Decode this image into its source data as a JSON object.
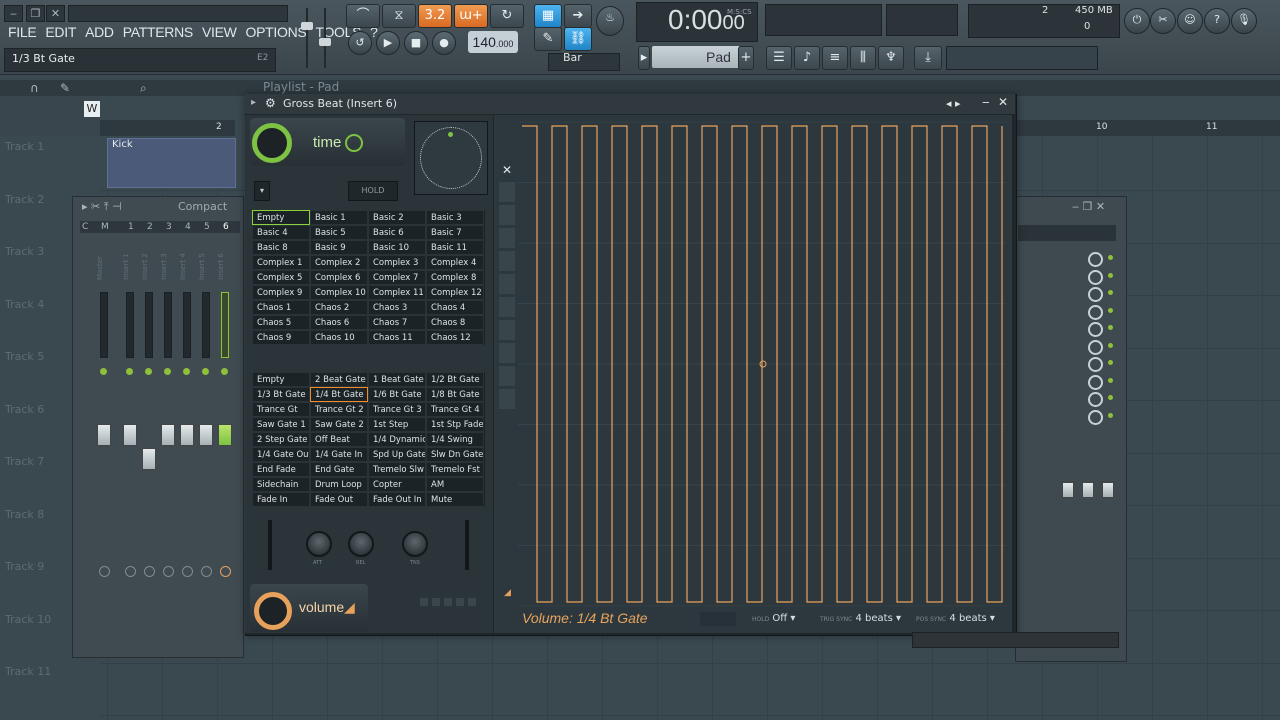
{
  "menu": [
    "FILE",
    "EDIT",
    "ADD",
    "PATTERNS",
    "VIEW",
    "OPTIONS",
    "TOOLS",
    "?"
  ],
  "hint": {
    "text": "1/3 Bt Gate",
    "shortcut": "E2"
  },
  "toolbar": {
    "pattern_counter": "3.2",
    "tempo": "140",
    "tempo_decimal": ".000",
    "time": "0:00",
    "time_sub": "00",
    "time_unit": "M:S:CS",
    "cpu": "2",
    "memory": "450 MB",
    "poly": "0",
    "snap": "Bar",
    "pad": "Pad"
  },
  "playlist": {
    "title": "Playlist - Pad",
    "ruler": [
      "2",
      "10",
      "11"
    ],
    "tracks": [
      "Track 1",
      "Track 2",
      "Track 3",
      "Track 4",
      "Track 5",
      "Track 6",
      "Track 7",
      "Track 8",
      "Track 9",
      "Track 10",
      "Track 11"
    ],
    "clip": "Kick"
  },
  "mixer": {
    "mode": "Compact",
    "cm": [
      "C",
      "M"
    ],
    "channels": [
      "1",
      "2",
      "3",
      "4",
      "5",
      "6"
    ],
    "labels": [
      "Master",
      "Insert 1",
      "Insert 2",
      "Insert 3",
      "Insert 4",
      "Insert 5",
      "Insert 6"
    ]
  },
  "gross_beat": {
    "title": "Gross Beat (Insert 6)",
    "time_label": "time",
    "volume_label": "volume",
    "hold": "HOLD",
    "time_presets": [
      "Empty",
      "Basic 1",
      "Basic 2",
      "Basic 3",
      "Basic 4",
      "Basic 5",
      "Basic 6",
      "Basic 7",
      "Basic 8",
      "Basic 9",
      "Basic 10",
      "Basic 11",
      "Complex 1",
      "Complex 2",
      "Complex 3",
      "Complex 4",
      "Complex 5",
      "Complex 6",
      "Complex 7",
      "Complex 8",
      "Complex 9",
      "Complex 10",
      "Complex 11",
      "Complex 12",
      "Chaos 1",
      "Chaos 2",
      "Chaos 3",
      "Chaos 4",
      "Chaos 5",
      "Chaos 6",
      "Chaos 7",
      "Chaos 8",
      "Chaos 9",
      "Chaos 10",
      "Chaos 11",
      "Chaos 12"
    ],
    "volume_presets": [
      "Empty",
      "2 Beat Gate",
      "1 Beat Gate",
      "1/2 Bt Gate",
      "1/3 Bt Gate",
      "1/4 Bt Gate",
      "1/6 Bt Gate",
      "1/8 Bt Gate",
      "Trance Gt",
      "Trance Gt 2",
      "Trance Gt 3",
      "Trance Gt 4",
      "Saw Gate 1",
      "Saw Gate 2",
      "1st Step",
      "1st Stp Fade",
      "2 Step Gate",
      "Off Beat",
      "1/4 Dynamic",
      "1/4 Swing",
      "1/4 Gate Out",
      "1/4 Gate In",
      "Spd Up Gate",
      "Slw Dn Gate",
      "End Fade",
      "End Gate",
      "Tremelo Slw",
      "Tremelo Fst",
      "Sidechain",
      "Drum Loop",
      "Copter",
      "AM",
      "Fade In",
      "Fade Out",
      "Fade Out In",
      "Mute"
    ],
    "knobs": [
      "ATT",
      "REL",
      "TNS"
    ],
    "envelope_label": "Volume: 1/4 Bt Gate",
    "hold_label": "HOLD",
    "hold_value": "Off",
    "trig_sync_label": "TRIG SYNC",
    "trig_sync_value": "4 beats",
    "pos_sync_label": "POS SYNC",
    "pos_sync_value": "4 beats",
    "gate_count": 16
  },
  "colors": {
    "accent_green": "#7dc242",
    "accent_orange": "#e7a15a",
    "envelope": "#e8a35d"
  }
}
